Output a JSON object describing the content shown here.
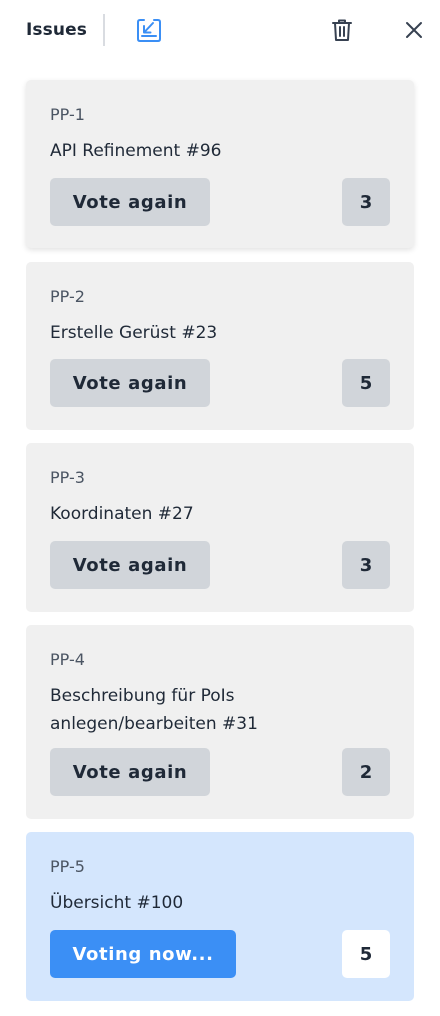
{
  "header": {
    "title": "Issues",
    "icons": [
      "import-icon",
      "trash-icon",
      "close-icon"
    ],
    "accent_color": "#3b8ff5"
  },
  "issues": [
    {
      "key": "PP-1",
      "title": "API Refinement #96",
      "button": "Vote again",
      "score": "3",
      "state": "done"
    },
    {
      "key": "PP-2",
      "title": "Erstelle Gerüst #23",
      "button": "Vote again",
      "score": "5",
      "state": "done"
    },
    {
      "key": "PP-3",
      "title": "Koordinaten #27",
      "button": "Vote again",
      "score": "3",
      "state": "done"
    },
    {
      "key": "PP-4",
      "title": "Beschreibung für PoIs anlegen/bearbeiten #31",
      "button": "Vote again",
      "score": "2",
      "state": "done"
    },
    {
      "key": "PP-5",
      "title": "Übersicht #100",
      "button": "Voting now...",
      "score": "5",
      "state": "active"
    }
  ],
  "colors": {
    "card_bg": "#f0f0f0",
    "active_card_bg": "#d4e6fd",
    "button_bg": "#d1d5da",
    "primary_button_bg": "#3b8ff5"
  }
}
